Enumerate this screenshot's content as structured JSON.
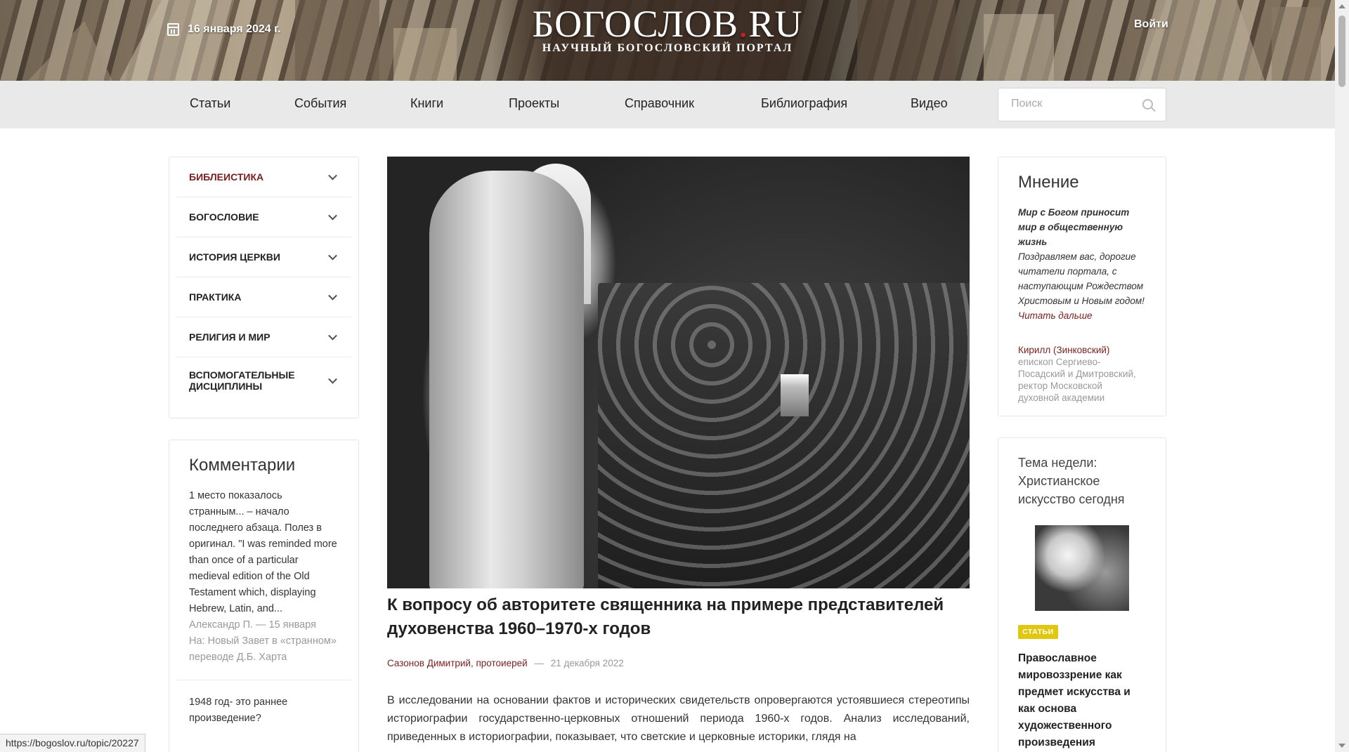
{
  "header": {
    "date": "16 января 2024 г.",
    "logo_main": "БОГОСЛОВ",
    "logo_dot": ".",
    "logo_tld": "RU",
    "logo_sub": "НАУЧНЫЙ БОГОСЛОВСКИЙ ПОРТАЛ",
    "login": "Войти"
  },
  "nav": {
    "items": [
      "Статьи",
      "События",
      "Книги",
      "Проекты",
      "Справочник",
      "Библиография",
      "Видео"
    ],
    "search_placeholder": "Поиск"
  },
  "categories": [
    {
      "label": "БИБЛЕИСТИКА",
      "active": true
    },
    {
      "label": "БОГОСЛОВИЕ",
      "active": false
    },
    {
      "label": "ИСТОРИЯ ЦЕРКВИ",
      "active": false
    },
    {
      "label": "ПРАКТИКА",
      "active": false
    },
    {
      "label": "РЕЛИГИЯ И МИР",
      "active": false
    },
    {
      "label": "ВСПОМОГАТЕЛЬНЫЕ ДИСЦИПЛИНЫ",
      "active": false
    }
  ],
  "comments": {
    "title": "Комментарии",
    "items": [
      {
        "text": "1 место показалось странным... – начало последнего абзаца. Полез в оригинал. \"I was reminded more than once of a particular medieval edition of the Old Testament which, displaying Hebrew, Latin, and...",
        "meta": "Александр П. — 15 января",
        "on": "На: Новый Завет в «странном» переводе Д.Б. Харта"
      },
      {
        "text": "1948 год- это раннее произведение?",
        "meta": "",
        "on": ""
      }
    ]
  },
  "article": {
    "title": "К вопросу об авторитете священника на примере представителей духовенства 1960–1970-х годов",
    "author": "Сазонов Димитрий, протоиерей",
    "separator": "—",
    "date": "21 декабря 2022",
    "body": "В исследовании на основании фактов и исторических свидетельств опровергаются устоявшиеся стереотипы историографии государственно-церковных отношений периода 1960-х годов. Анализ исследований, приведенных в историографии, показывает, что светские и церковные историки, глядя на"
  },
  "opinion": {
    "title": "Мнение",
    "headline": "Мир с Богом приносит мир в общественную жизнь",
    "text": "Поздравляем вас, дорогие читатели портала, с наступающим Рождеством Христовым и Новым годом!",
    "more": "Читать дальше",
    "person_name": "Кирилл (Зинковский)",
    "person_role": "епископ Сергиево-Посадский и Дмитровский, ректор Московской духовной академии"
  },
  "week": {
    "title": "Тема недели: Христианское искусство сегодня",
    "tag": "СТАТЬИ",
    "post_title": "Православное мировоззрение как предмет искусства и как основа художественного произведения"
  },
  "status_bar": {
    "url": "https://bogoslov.ru/topic/20227"
  },
  "colors": {
    "accent": "#7a1f1f",
    "nav_bg": "#e9e9e9",
    "tag": "#e1c80e",
    "logo_dot": "#c8201e"
  }
}
